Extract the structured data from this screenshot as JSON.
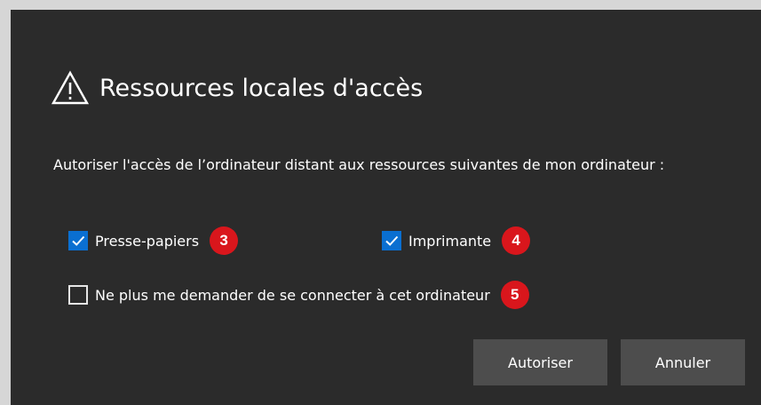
{
  "dialog": {
    "title": "Ressources locales d'accès",
    "description": "Autoriser l'accès de l’ordinateur distant aux ressources suivantes de mon ordinateur :",
    "options": {
      "clipboard": {
        "label": "Presse-papiers",
        "checked": true,
        "badge": "3"
      },
      "printer": {
        "label": "Imprimante",
        "checked": true,
        "badge": "4"
      },
      "dont_ask": {
        "label": "Ne plus me demander de se connecter à cet ordinateur",
        "checked": false,
        "badge": "5"
      }
    },
    "buttons": {
      "allow": "Autoriser",
      "cancel": "Annuler"
    }
  },
  "colors": {
    "dialog_bg": "#2b2b2b",
    "page_bg": "#d6d6d6",
    "checkbox_accent": "#0a6fd1",
    "badge_red": "#d9161c",
    "button_bg": "#4d4d4d"
  },
  "icons": {
    "title": "warning-triangle-icon",
    "checked": "checkmark-icon"
  }
}
